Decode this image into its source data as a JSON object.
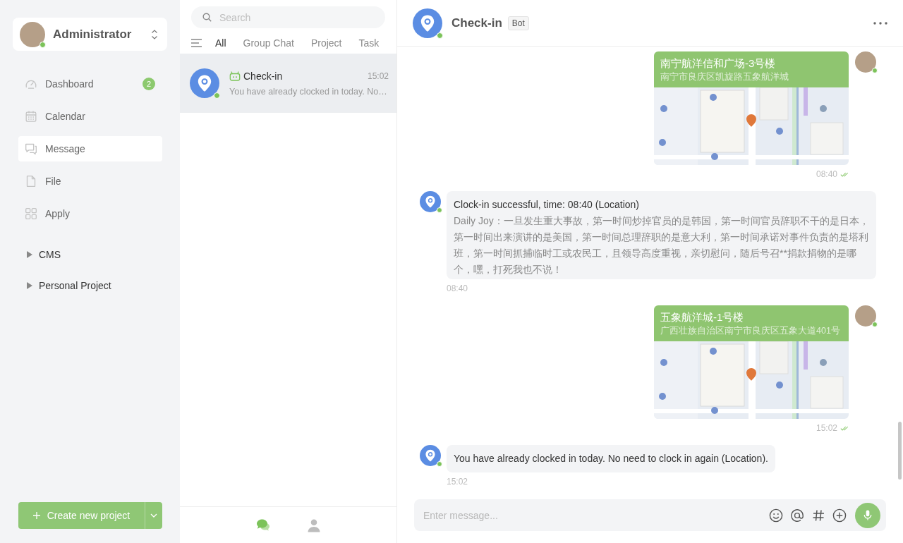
{
  "sidebar": {
    "user": {
      "name": "Administrator",
      "online": true
    },
    "nav": [
      {
        "kind": "dashboard",
        "label": "Dashboard",
        "badge": "2",
        "selected": false
      },
      {
        "kind": "calendar",
        "label": "Calendar",
        "selected": false
      },
      {
        "kind": "message",
        "label": "Message",
        "selected": true
      },
      {
        "kind": "file",
        "label": "File",
        "selected": false
      },
      {
        "kind": "apply",
        "label": "Apply",
        "selected": false
      }
    ],
    "groups": [
      {
        "label": "CMS",
        "expanded": false
      },
      {
        "label": "Personal Project",
        "expanded": false
      }
    ],
    "create_button": {
      "label": "Create new project"
    }
  },
  "conversations": {
    "search": {
      "placeholder": "Search"
    },
    "filters": [
      {
        "label": "All",
        "selected": true
      },
      {
        "label": "Group Chat",
        "selected": false
      },
      {
        "label": "Project",
        "selected": false
      },
      {
        "label": "Task",
        "selected": false
      }
    ],
    "items": [
      {
        "name": "Check-in",
        "bot": true,
        "online": true,
        "time": "15:02",
        "preview": "You have already clocked in today. No…",
        "selected": true
      }
    ],
    "bottom_tabs": [
      {
        "kind": "chats",
        "selected": true
      },
      {
        "kind": "contacts",
        "selected": false
      }
    ]
  },
  "chat": {
    "title": "Check-in",
    "tag": "Bot",
    "online": true,
    "messages": [
      {
        "kind": "location",
        "outgoing": true,
        "title": "南宁航洋信和广场-3号楼",
        "address": "南宁市良庆区凯旋路五象航洋城",
        "time": "08:40",
        "read": true
      },
      {
        "kind": "text",
        "outgoing": false,
        "title": "Clock-in successful, time: 08:40 (Location)",
        "body": "Daily Joy：一旦发生重大事故，第一时间炒掉官员的是韩国，第一时间官员辞职不干的是日本，第一时间出来演讲的是美国，第一时间总理辞职的是意大利，第一时间承诺对事件负责的是塔利班，第一时间抓捕临时工或农民工，且领导高度重视，亲切慰问，随后号召**捐款捐物的是哪个，嘿，打死我也不说！",
        "time": "08:40"
      },
      {
        "kind": "location",
        "outgoing": true,
        "title": "五象航洋城-1号楼",
        "address": "广西壮族自治区南宁市良庆区五象大道401号",
        "time": "15:02",
        "read": true
      },
      {
        "kind": "text",
        "outgoing": false,
        "title": "You have already clocked in today. No need to clock in again (Location).",
        "time": "15:02"
      }
    ],
    "composer": {
      "placeholder": "Enter message..."
    }
  }
}
